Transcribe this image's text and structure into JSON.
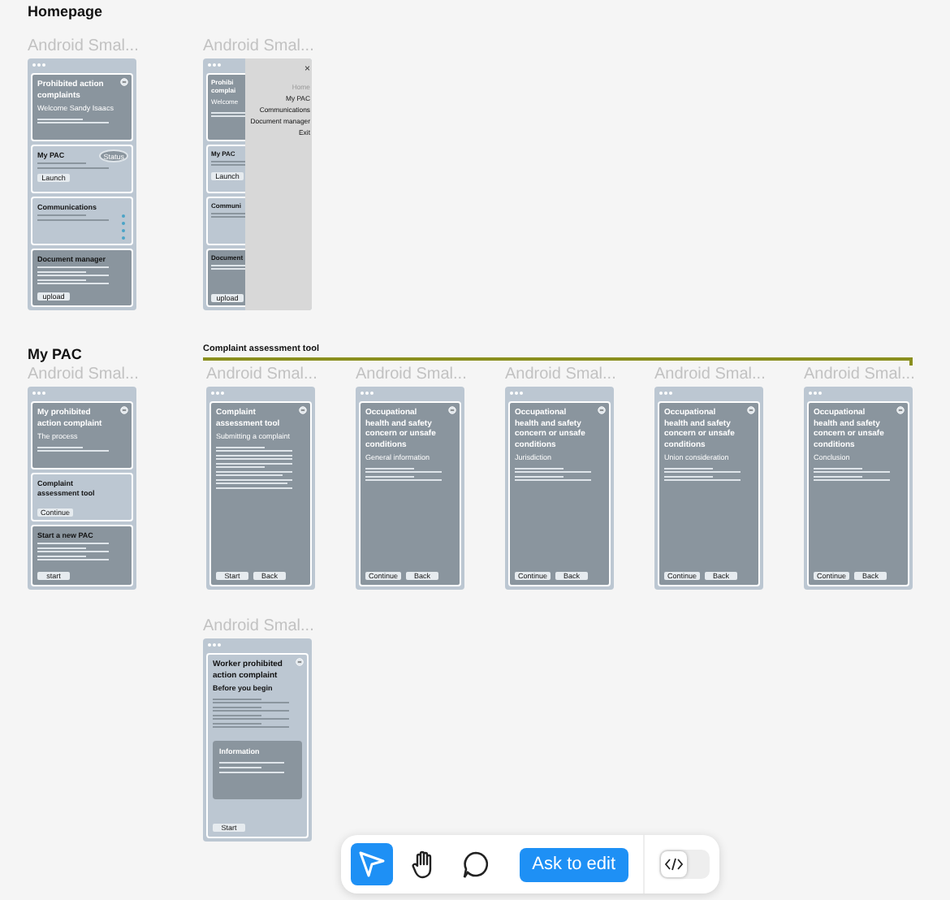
{
  "sections": [
    {
      "heading": "Homepage"
    },
    {
      "heading": "My PAC"
    }
  ],
  "flow": {
    "label": "Complaint assessment tool"
  },
  "frames": [
    {
      "label": "Android Smal...",
      "cards": [
        {
          "kind": "hero",
          "title": "Prohibited action complaints",
          "subtitle": "Welcome Sandy Isaacs",
          "icon": true
        },
        {
          "kind": "light",
          "title": "My PAC",
          "badge": "Status",
          "button": "Launch"
        },
        {
          "kind": "light",
          "title": "Communications",
          "dots": true
        },
        {
          "kind": "dark",
          "title": "Document manager",
          "button": "upload"
        }
      ]
    },
    {
      "label": "Android Smal...",
      "cards": [
        {
          "kind": "hero",
          "title": "Prohibi complai",
          "subtitle": "Welcome"
        },
        {
          "kind": "light",
          "title": "My PAC",
          "button": "Launch"
        },
        {
          "kind": "light",
          "title": "Communi"
        },
        {
          "kind": "dark",
          "title": "Document",
          "button": "upload"
        }
      ],
      "menu": {
        "close": "×",
        "items": [
          {
            "label": "Home",
            "disabled": true
          },
          {
            "label": "My PAC",
            "disabled": false
          },
          {
            "label": "Communications",
            "disabled": false
          },
          {
            "label": "Document manager",
            "disabled": false
          },
          {
            "label": "Exit",
            "disabled": false
          }
        ]
      }
    },
    {
      "label": "Android Smal...",
      "cards": [
        {
          "kind": "hero",
          "title": "My prohibited action complaint",
          "subtitle": "The process",
          "icon": true
        },
        {
          "kind": "light",
          "title": "Complaint assessment tool",
          "button": "Continue"
        },
        {
          "kind": "dark",
          "title": "Start a new PAC",
          "button": "start"
        }
      ]
    },
    {
      "label": "Android Smal...",
      "cards": [
        {
          "kind": "full",
          "title": "Complaint assessment tool",
          "subtitle": "Submitting a complaint",
          "icon": true,
          "buttons": [
            "Start",
            "Back"
          ]
        }
      ]
    },
    {
      "label": "Android Smal...",
      "cards": [
        {
          "kind": "full",
          "title": "Occupational health and safety concern or unsafe conditions",
          "subtitle": "General information",
          "icon": true,
          "buttons": [
            "Continue",
            "Back"
          ]
        }
      ]
    },
    {
      "label": "Android Smal...",
      "cards": [
        {
          "kind": "full",
          "title": "Occupational health and safety concern or unsafe conditions",
          "subtitle": "Jurisdiction",
          "icon": true,
          "buttons": [
            "Continue",
            "Back"
          ]
        }
      ]
    },
    {
      "label": "Android Smal...",
      "cards": [
        {
          "kind": "full",
          "title": "Occupational health and safety concern or unsafe conditions",
          "subtitle": "Union consideration",
          "icon": true,
          "buttons": [
            "Continue",
            "Back"
          ]
        }
      ]
    },
    {
      "label": "Android Smal...",
      "cards": [
        {
          "kind": "full",
          "title": "Occupational health and safety concern or unsafe conditions",
          "subtitle": "Conclusion",
          "icon": true,
          "buttons": [
            "Continue",
            "Back"
          ]
        }
      ]
    },
    {
      "label": "Android Smal...",
      "cards": [
        {
          "kind": "full_light",
          "title": "Worker prohibited action complaint",
          "subtitle": "Before you begin",
          "icon": true,
          "note": "Information",
          "buttons": [
            "Start"
          ]
        }
      ]
    }
  ],
  "toolbar": {
    "tools": [
      {
        "kind": "pointer",
        "selected": true
      },
      {
        "kind": "hand",
        "selected": false
      },
      {
        "kind": "comment",
        "selected": false
      }
    ],
    "action": "Ask to edit",
    "code_toggle": {
      "on": false
    }
  }
}
